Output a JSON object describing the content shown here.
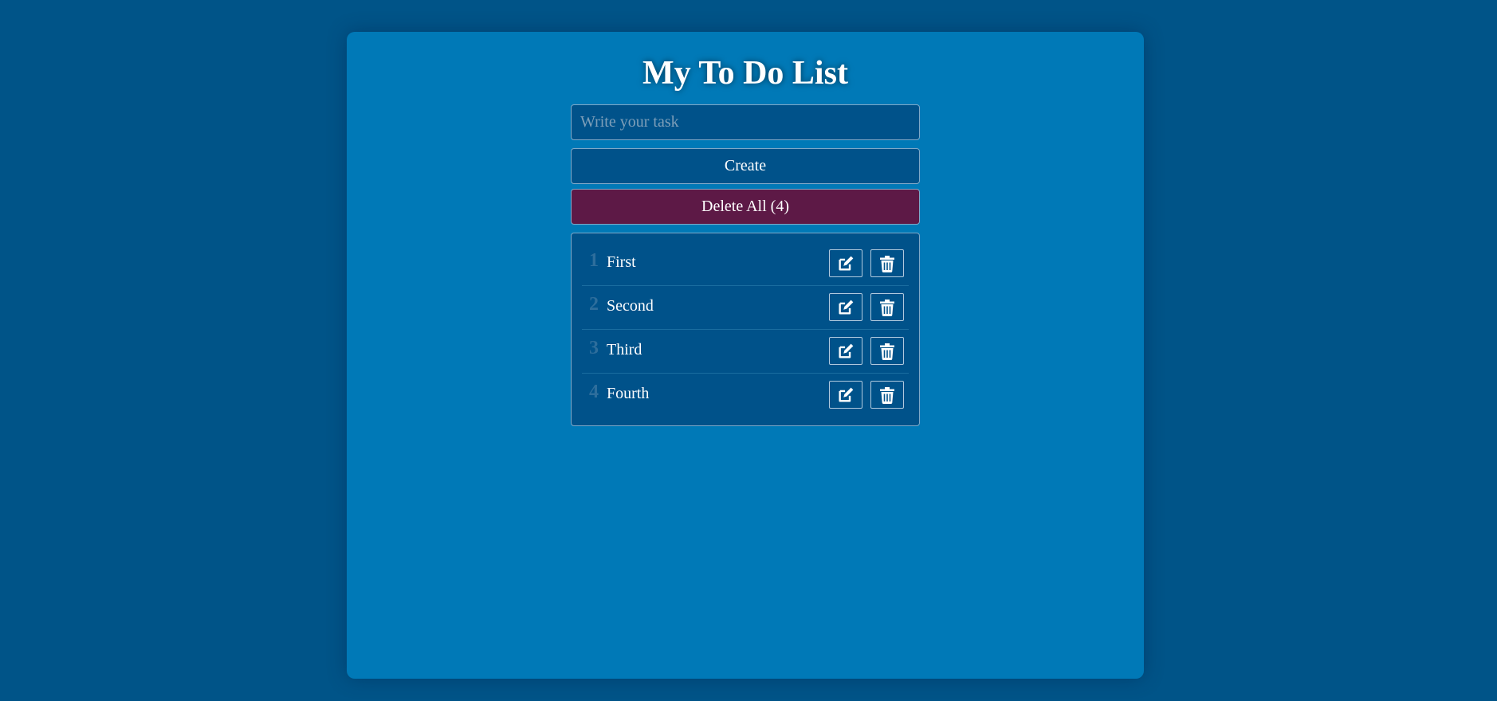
{
  "app": {
    "title": "My To Do List"
  },
  "input": {
    "placeholder": "Write your task",
    "value": ""
  },
  "buttons": {
    "create_label": "Create",
    "delete_all_label": "Delete All (4)"
  },
  "tasks": [
    {
      "number": "1",
      "text": "First"
    },
    {
      "number": "2",
      "text": "Second"
    },
    {
      "number": "3",
      "text": "Third"
    },
    {
      "number": "4",
      "text": "Fourth"
    }
  ],
  "icons": {
    "edit": "edit-icon",
    "delete": "trash-icon"
  },
  "colors": {
    "page_background": "#005488",
    "card_background": "#0079b7",
    "field_background": "#00528a",
    "delete_all_background": "#5d1946",
    "text": "#ffffff"
  }
}
